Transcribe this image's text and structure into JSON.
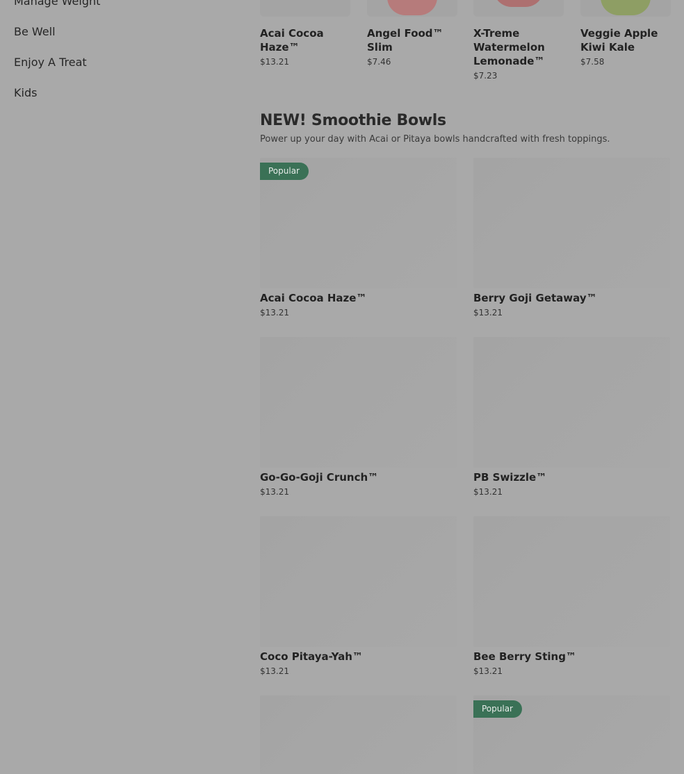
{
  "sidebar": {
    "items": [
      {
        "label": "Manage Weight"
      },
      {
        "label": "Be Well"
      },
      {
        "label": "Enjoy A Treat"
      },
      {
        "label": "Kids"
      }
    ]
  },
  "top_products": [
    {
      "name": "Acai Cocoa Haze™",
      "price": "$13.21"
    },
    {
      "name": "Angel Food™ Slim",
      "price": "$7.46"
    },
    {
      "name": "X-Treme Watermelon Lemonade™",
      "price": "$7.23"
    },
    {
      "name": "Veggie Apple Kiwi Kale",
      "price": "$7.58"
    }
  ],
  "section": {
    "title": "NEW! Smoothie Bowls",
    "subtitle": "Power up your day with Acai or Pitaya bowls handcrafted with fresh toppings."
  },
  "bowls": [
    {
      "name": "Acai Cocoa Haze™",
      "price": "$13.21",
      "badge": "Popular"
    },
    {
      "name": "Berry Goji Getaway™",
      "price": "$13.21"
    },
    {
      "name": "Go-Go-Goji Crunch™",
      "price": "$13.21"
    },
    {
      "name": "PB Swizzle™",
      "price": "$13.21"
    },
    {
      "name": "Coco Pitaya-Yah™",
      "price": "$13.21"
    },
    {
      "name": "Bee Berry Sting™",
      "price": "$13.21"
    },
    {},
    {
      "badge": "Popular"
    }
  ]
}
